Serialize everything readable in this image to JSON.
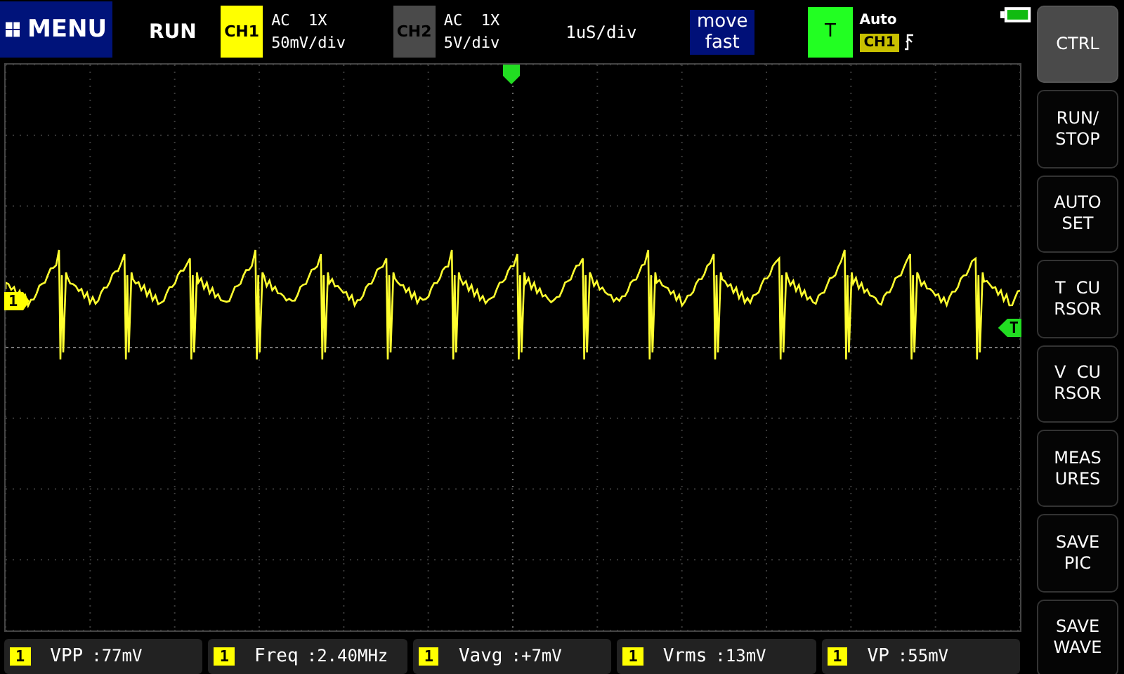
{
  "top_bar": {
    "menu_label": "MENU",
    "run_state": "RUN",
    "channels": [
      {
        "badge": "CH1",
        "enabled": true,
        "coupling": "AC  1X",
        "scale": "50mV/div"
      },
      {
        "badge": "CH2",
        "enabled": false,
        "coupling": "AC  1X",
        "scale": "5V/div"
      }
    ],
    "timebase": "1uS/div",
    "move_mode": [
      "move",
      "fast"
    ],
    "trigger": {
      "badge": "T",
      "mode": "Auto",
      "source": "CH1"
    }
  },
  "screen": {
    "channel_marker": "1",
    "trigger_marker": "T"
  },
  "measurements": [
    {
      "channel": "1",
      "name": "VPP",
      "value": ":77mV"
    },
    {
      "channel": "1",
      "name": "Freq",
      "value": ":2.40MHz"
    },
    {
      "channel": "1",
      "name": "Vavg",
      "value": ":+7mV"
    },
    {
      "channel": "1",
      "name": "Vrms",
      "value": ":13mV"
    },
    {
      "channel": "1",
      "name": "VP",
      "value": ":55mV"
    }
  ],
  "side_buttons": [
    {
      "lines": [
        "CTRL"
      ],
      "selected": true
    },
    {
      "lines": [
        "RUN/",
        "STOP"
      ],
      "selected": false
    },
    {
      "lines": [
        "AUTO",
        "SET"
      ],
      "selected": false
    },
    {
      "lines": [
        "T  CU",
        "RSOR"
      ],
      "selected": false
    },
    {
      "lines": [
        "V  CU",
        "RSOR"
      ],
      "selected": false
    },
    {
      "lines": [
        "MEAS",
        "URES"
      ],
      "selected": false
    },
    {
      "lines": [
        "SAVE",
        "PIC"
      ],
      "selected": false
    },
    {
      "lines": [
        "SAVE",
        "WAVE"
      ],
      "selected": false
    }
  ]
}
